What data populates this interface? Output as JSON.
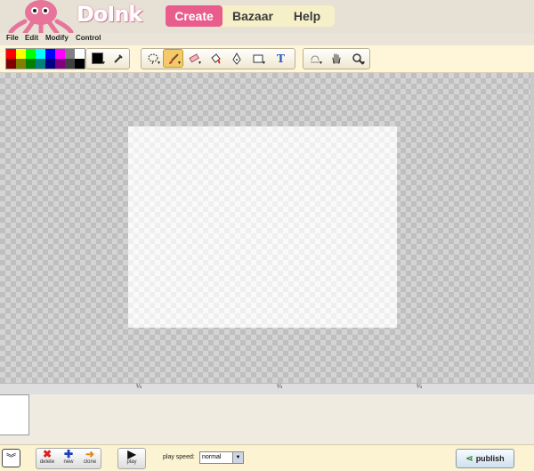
{
  "header": {
    "logo_text": "DoInk",
    "nav": [
      {
        "label": "Create",
        "active": true
      },
      {
        "label": "Bazaar",
        "active": false
      },
      {
        "label": "Help",
        "active": false
      }
    ]
  },
  "menu": [
    "File",
    "Edit",
    "Modify",
    "Control"
  ],
  "palette": {
    "colors_row1": [
      "#ff0000",
      "#ffff00",
      "#00ff00",
      "#00ffff",
      "#0000ff",
      "#ff00ff",
      "#808080",
      "#ffffff"
    ],
    "colors_row2": [
      "#800000",
      "#808000",
      "#008000",
      "#008080",
      "#000080",
      "#800080",
      "#404040",
      "#000000"
    ]
  },
  "tools": {
    "color_icon": "black-square-icon",
    "eyedropper_icon": "eyedropper-icon",
    "select": "lasso-select-icon",
    "brush": "brush-icon",
    "eraser": "eraser-icon",
    "fill": "paint-bucket-icon",
    "pen": "pen-nib-icon",
    "shape": "rectangle-icon",
    "text_glyph": "T",
    "onion": "onion-skin-icon",
    "hand": "hand-icon",
    "zoom": "magnifier-icon"
  },
  "timeline": {
    "ticks": [
      "¼",
      "¼",
      "¼"
    ]
  },
  "bottom": {
    "delete_label": "delete",
    "new_label": "new",
    "clone_label": "clone",
    "play_label": "play",
    "speed_label": "play speed:",
    "speed_value": "normal",
    "publish_label": "publish"
  }
}
